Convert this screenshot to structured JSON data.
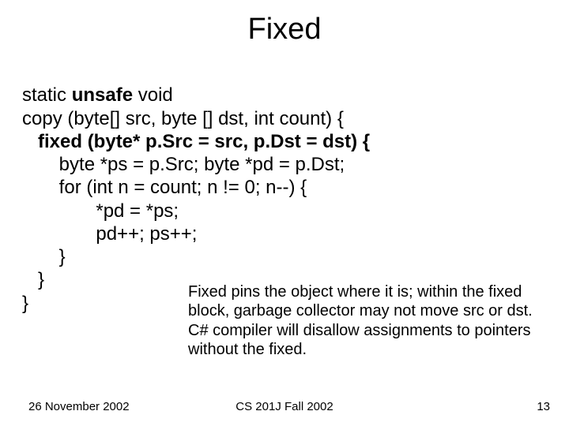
{
  "title": "Fixed",
  "code": {
    "l01a": "static ",
    "l01b": "unsafe ",
    "l01c": "void",
    "l02": "copy (byte[] src, byte [] dst, int count) {",
    "l03": "   fixed (byte* p.Src = src, p.Dst = dst) {",
    "l04": "       byte *ps = p.Src; byte *pd = p.Dst;",
    "l05": "       for (int n = count; n != 0; n--) {",
    "l06": "              *pd = *ps;",
    "l07": "              pd++; ps++;",
    "l08": "       }",
    "l09": "   }",
    "l10": "}"
  },
  "note": "Fixed pins the object where it is; within the fixed block, garbage collector may not move src or dst.  C# compiler will disallow assignments to pointers without the fixed.",
  "footer": {
    "date": "26 November 2002",
    "course": "CS 201J Fall 2002",
    "page": "13"
  }
}
